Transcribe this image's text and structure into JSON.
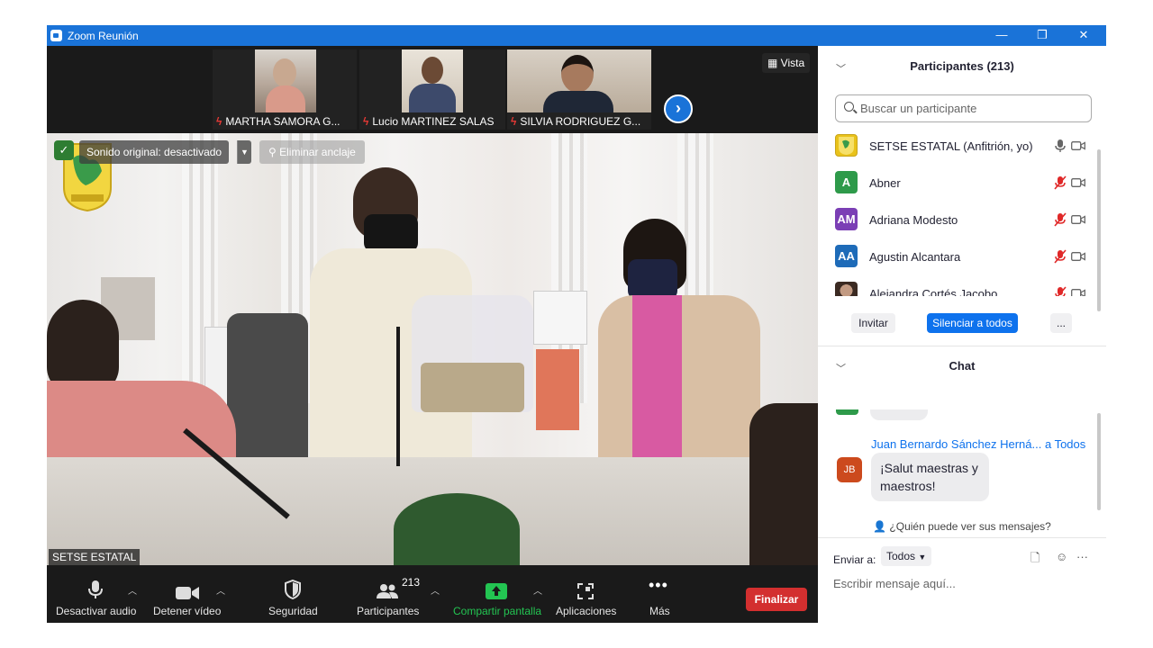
{
  "window": {
    "title": "Zoom Reunión",
    "minimize": "—",
    "restore": "❐",
    "close": "✕"
  },
  "strip": {
    "thumbnails": [
      {
        "name": "MARTHA SAMORA G..."
      },
      {
        "name": "Lucio MARTINEZ SALAS"
      },
      {
        "name": "SILVIA RODRIGUEZ G..."
      }
    ],
    "next": "›",
    "view_label": "Vista"
  },
  "main_video": {
    "original_sound": "Sonido original: desactivado",
    "unpin": "Eliminar anclaje",
    "speaker": "SETSE ESTATAL"
  },
  "toolbar": {
    "audio": "Desactivar audio",
    "video": "Detener vídeo",
    "security": "Seguridad",
    "participants": "Participantes",
    "participants_count": "213",
    "share": "Compartir pantalla",
    "apps": "Aplicaciones",
    "more": "Más",
    "end": "Finalizar"
  },
  "participants_panel": {
    "title": "Participantes (213)",
    "search_placeholder": "Buscar un participante",
    "list": [
      {
        "name": "SETSE ESTATAL (Anfitrión, yo)",
        "initials": "",
        "color": "#e9c21a"
      },
      {
        "name": "Abner",
        "initials": "A",
        "color": "#2e9a4a"
      },
      {
        "name": "Adriana Modesto",
        "initials": "AM",
        "color": "#7b3fb5"
      },
      {
        "name": "Agustin Alcantara",
        "initials": "AA",
        "color": "#1e6bb8"
      },
      {
        "name": "Alejandra Cortés Jacobo",
        "initials": "",
        "color": "#8a6a58"
      }
    ],
    "invite": "Invitar",
    "mute_all": "Silenciar a todos",
    "more": "..."
  },
  "chat": {
    "title": "Chat",
    "sender": "Juan Bernardo Sánchez Herná...",
    "to": "a Todos",
    "sender_initials": "JB",
    "message": "¡Salut maestras y maestros!",
    "who_sees": "¿Quién puede ver sus mensajes?",
    "send_to_label": "Enviar a:",
    "send_to_value": "Todos",
    "input_placeholder": "Escribir mensaje aquí..."
  }
}
